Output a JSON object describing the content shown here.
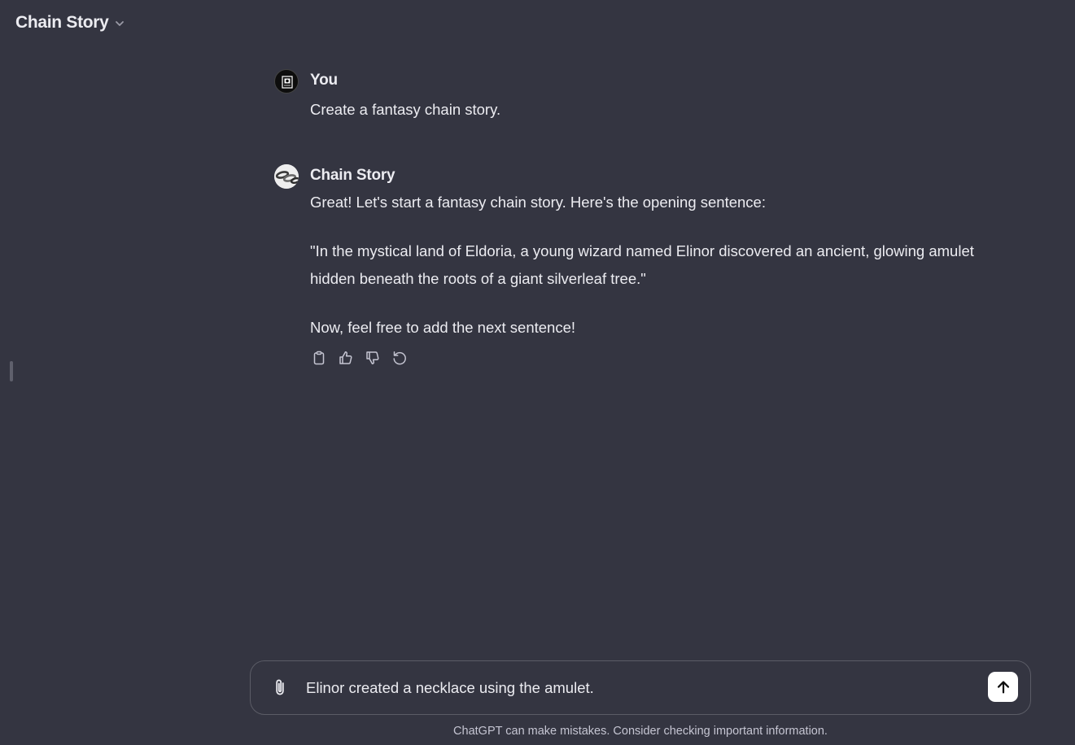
{
  "header": {
    "title": "Chain Story",
    "dropdown_icon": "chevron-down-icon"
  },
  "messages": {
    "user": {
      "author": "You",
      "text": "Create a fantasy chain story."
    },
    "bot": {
      "author": "Chain Story",
      "paragraphs": [
        "Great! Let's start a fantasy chain story. Here's the opening sentence:",
        "\"In the mystical land of Eldoria, a young wizard named Elinor discovered an ancient, glowing amulet hidden beneath the roots of a giant silverleaf tree.\"",
        "Now, feel free to add the next sentence!"
      ],
      "actions": [
        "copy-icon",
        "thumbs-up-icon",
        "thumbs-down-icon",
        "regenerate-icon"
      ]
    }
  },
  "composer": {
    "value": "Elinor created a necklace using the amulet.",
    "attach_icon": "paperclip-icon",
    "send_icon": "arrow-up-icon"
  },
  "footer": {
    "disclaimer": "ChatGPT can make mistakes. Consider checking important information."
  },
  "colors": {
    "background": "#343541",
    "text": "#ececf1",
    "muted": "#c5c5d2",
    "border": "#5b5c66",
    "send_button": "#ffffff"
  }
}
